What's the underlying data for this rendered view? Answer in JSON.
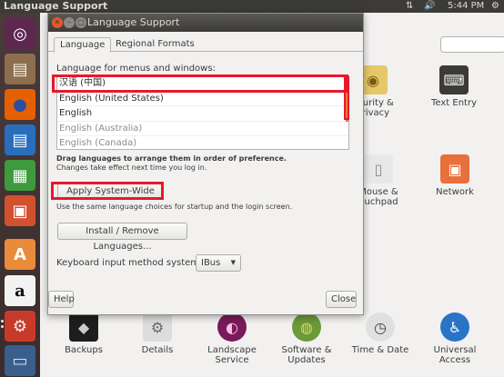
{
  "top_panel": {
    "title": "Language Support",
    "network_glyph": "⇅",
    "volume_glyph": "🔊",
    "time": "5:44 PM",
    "gear_glyph": "⚙"
  },
  "launcher": {
    "items": [
      {
        "icon": "ubuntu-logo-icon",
        "glyph": "◎"
      },
      {
        "icon": "files-icon",
        "glyph": "▤"
      },
      {
        "icon": "firefox-icon",
        "glyph": "●"
      },
      {
        "icon": "writer-icon",
        "glyph": "▤"
      },
      {
        "icon": "calc-icon",
        "glyph": "▦"
      },
      {
        "icon": "impress-icon",
        "glyph": "▣"
      },
      {
        "icon": "software-center-icon",
        "glyph": "A"
      },
      {
        "icon": "amazon-icon",
        "glyph": "a"
      },
      {
        "icon": "system-settings-icon",
        "glyph": "⚙"
      },
      {
        "icon": "workspace-icon",
        "glyph": "▭"
      }
    ]
  },
  "background_window": {
    "items": [
      {
        "label_lines": [
          "ecurity &",
          "Privacy"
        ],
        "icon": "security-icon",
        "glyph": "◉"
      },
      {
        "label_lines": [
          "Text Entry"
        ],
        "icon": "keyboard-icon",
        "glyph": "⌨"
      },
      {
        "label_lines": [
          "Mouse &",
          "ouchpad"
        ],
        "icon": "mouse-icon",
        "glyph": "▯"
      },
      {
        "label_lines": [
          "Network"
        ],
        "icon": "network-icon",
        "glyph": "▣"
      },
      {
        "label_lines": [
          "Backups"
        ],
        "icon": "backups-icon",
        "glyph": "◆"
      },
      {
        "label_lines": [
          "Details"
        ],
        "icon": "details-icon",
        "glyph": "⚙"
      },
      {
        "label_lines": [
          "Landscape",
          "Service"
        ],
        "icon": "landscape-icon",
        "glyph": "◐"
      },
      {
        "label_lines": [
          "Software &",
          "Updates"
        ],
        "icon": "software-updates-icon",
        "glyph": "◍"
      },
      {
        "label_lines": [
          "Time & Date"
        ],
        "icon": "clock-icon",
        "glyph": "◷"
      },
      {
        "label_lines": [
          "Universal",
          "Access"
        ],
        "icon": "universal-access-icon",
        "glyph": "♿"
      }
    ]
  },
  "dialog": {
    "title": "Language Support",
    "close_glyph": "✕",
    "minimize_glyph": "–",
    "maximize_glyph": "□",
    "tabs": [
      {
        "label": "Language",
        "active": true
      },
      {
        "label": "Regional Formats",
        "active": false
      }
    ],
    "language_heading": "Language for menus and windows:",
    "languages": [
      {
        "label": "汉语 (中国)",
        "dim": false
      },
      {
        "label": "English (United States)",
        "dim": false
      },
      {
        "label": "English",
        "dim": false
      },
      {
        "label": "English (Australia)",
        "dim": true
      },
      {
        "label": "English (Canada)",
        "dim": true
      }
    ],
    "drag_note_bold": "Drag languages to arrange them in order of preference.",
    "drag_note": "Changes take effect next time you log in.",
    "apply_label": "Apply System-Wide",
    "apply_note": "Use the same language choices for startup and the login screen.",
    "install_label": "Install / Remove Languages...",
    "keyboard_label": "Keyboard input method system:",
    "keyboard_value": "IBus",
    "keyboard_arrow": "▼",
    "help_label": "Help",
    "close_label": "Close"
  },
  "colors": {
    "highlight": "#e8182c",
    "panel": "#3c3b37",
    "accent": "#e07b39"
  }
}
